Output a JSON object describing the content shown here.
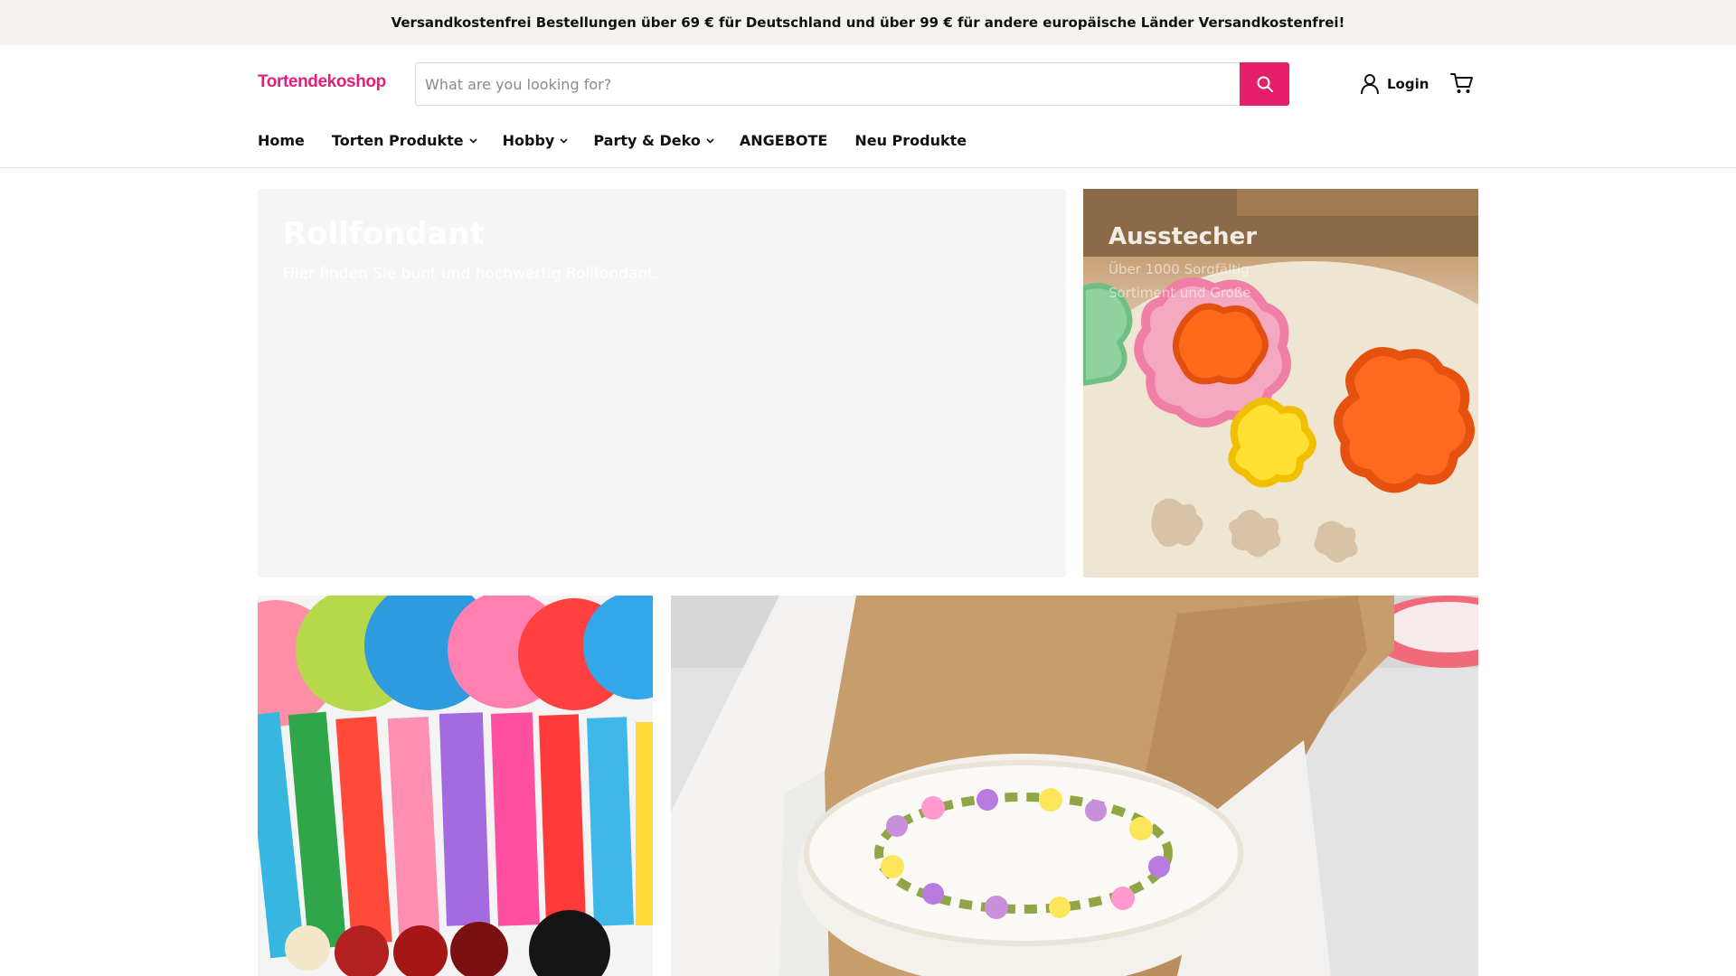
{
  "announcement": {
    "text": "Versandkostenfrei Bestellungen über 69 € für Deutschland und über 99 € für andere europäische Länder Versandkostenfrei!"
  },
  "header": {
    "logo": "Tortendekoshop",
    "search": {
      "placeholder": "What are you looking for?",
      "value": ""
    },
    "login_label": "Login"
  },
  "nav": {
    "items": [
      {
        "label": "Home",
        "dropdown": false
      },
      {
        "label": "Torten Produkte",
        "dropdown": true
      },
      {
        "label": "Hobby",
        "dropdown": true
      },
      {
        "label": "Party & Deko",
        "dropdown": true
      },
      {
        "label": "ANGEBOTE",
        "dropdown": false
      },
      {
        "label": "Neu Produkte",
        "dropdown": false
      }
    ]
  },
  "tiles": {
    "rollfondant": {
      "title": "Rollfondant",
      "subtitle": "Hier finden Sie bunt und hochwertig Rollfondant."
    },
    "ausstecher": {
      "title": "Ausstecher",
      "subtitle_line1": "Über 1000 Sorgfältig",
      "subtitle_line2": "Sortiment und Große"
    }
  },
  "colors": {
    "brand": "#e41e79",
    "search_button": "#e41e67",
    "announcement_bg": "#f3f2ee"
  },
  "icons": {
    "search": "search-icon",
    "user": "user-icon",
    "cart": "cart-icon",
    "chevron": "chevron-down-icon"
  }
}
